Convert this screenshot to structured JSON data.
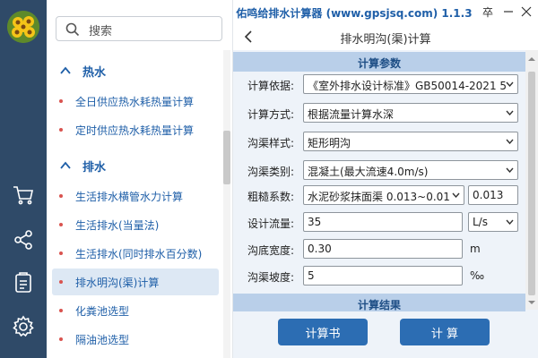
{
  "window": {
    "title": "佑鸣给排水计算器 (www.gpsjsq.com) 1.1.3",
    "pin_glyph": "卒"
  },
  "sidebar_rail": {
    "icons": [
      "logo-sunflower",
      "cart-icon",
      "share-icon",
      "clipboard-icon",
      "settings-icon"
    ]
  },
  "menu": {
    "search_placeholder": "搜索",
    "categories": [
      {
        "label": "热水",
        "items": [
          "全日供应热水耗热量计算",
          "定时供应热水耗热量计算"
        ]
      },
      {
        "label": "排水",
        "items": [
          "生活排水横管水力计算",
          "生活排水(当量法)",
          "生活排水(同时排水百分数)",
          "排水明沟(渠)计算",
          "化粪池选型",
          "隔油池选型"
        ]
      }
    ],
    "active_item": "排水明沟(渠)计算"
  },
  "page": {
    "back_label": "<",
    "title": "排水明沟(渠)计算",
    "params_header": "计算参数",
    "results_header": "计算结果",
    "fields": {
      "basis": {
        "label": "计算依据:",
        "value": "《室外排水设计标准》GB50014-2021 5"
      },
      "method": {
        "label": "计算方式:",
        "value": "根据流量计算水深"
      },
      "style": {
        "label": "沟渠样式:",
        "value": "矩形明沟"
      },
      "type": {
        "label": "沟渠类别:",
        "value": "混凝土(最大流速4.0m/s)"
      },
      "roughness": {
        "label": "粗糙系数:",
        "value": "水泥砂浆抹面渠 0.013~0.01",
        "number": "0.013"
      },
      "flow": {
        "label": "设计流量:",
        "value": "35",
        "unit": "L/s"
      },
      "width": {
        "label": "沟底宽度:",
        "value": "0.30",
        "unit": "m"
      },
      "slope": {
        "label": "沟渠坡度:",
        "value": "5",
        "unit": "‰"
      }
    },
    "buttons": {
      "report": "计算书",
      "calc": "计 算"
    }
  },
  "colors": {
    "rail": "#2f4a68",
    "accent": "#1f5fa8",
    "section": "#b9cfe9",
    "button": "#2c6db3"
  }
}
